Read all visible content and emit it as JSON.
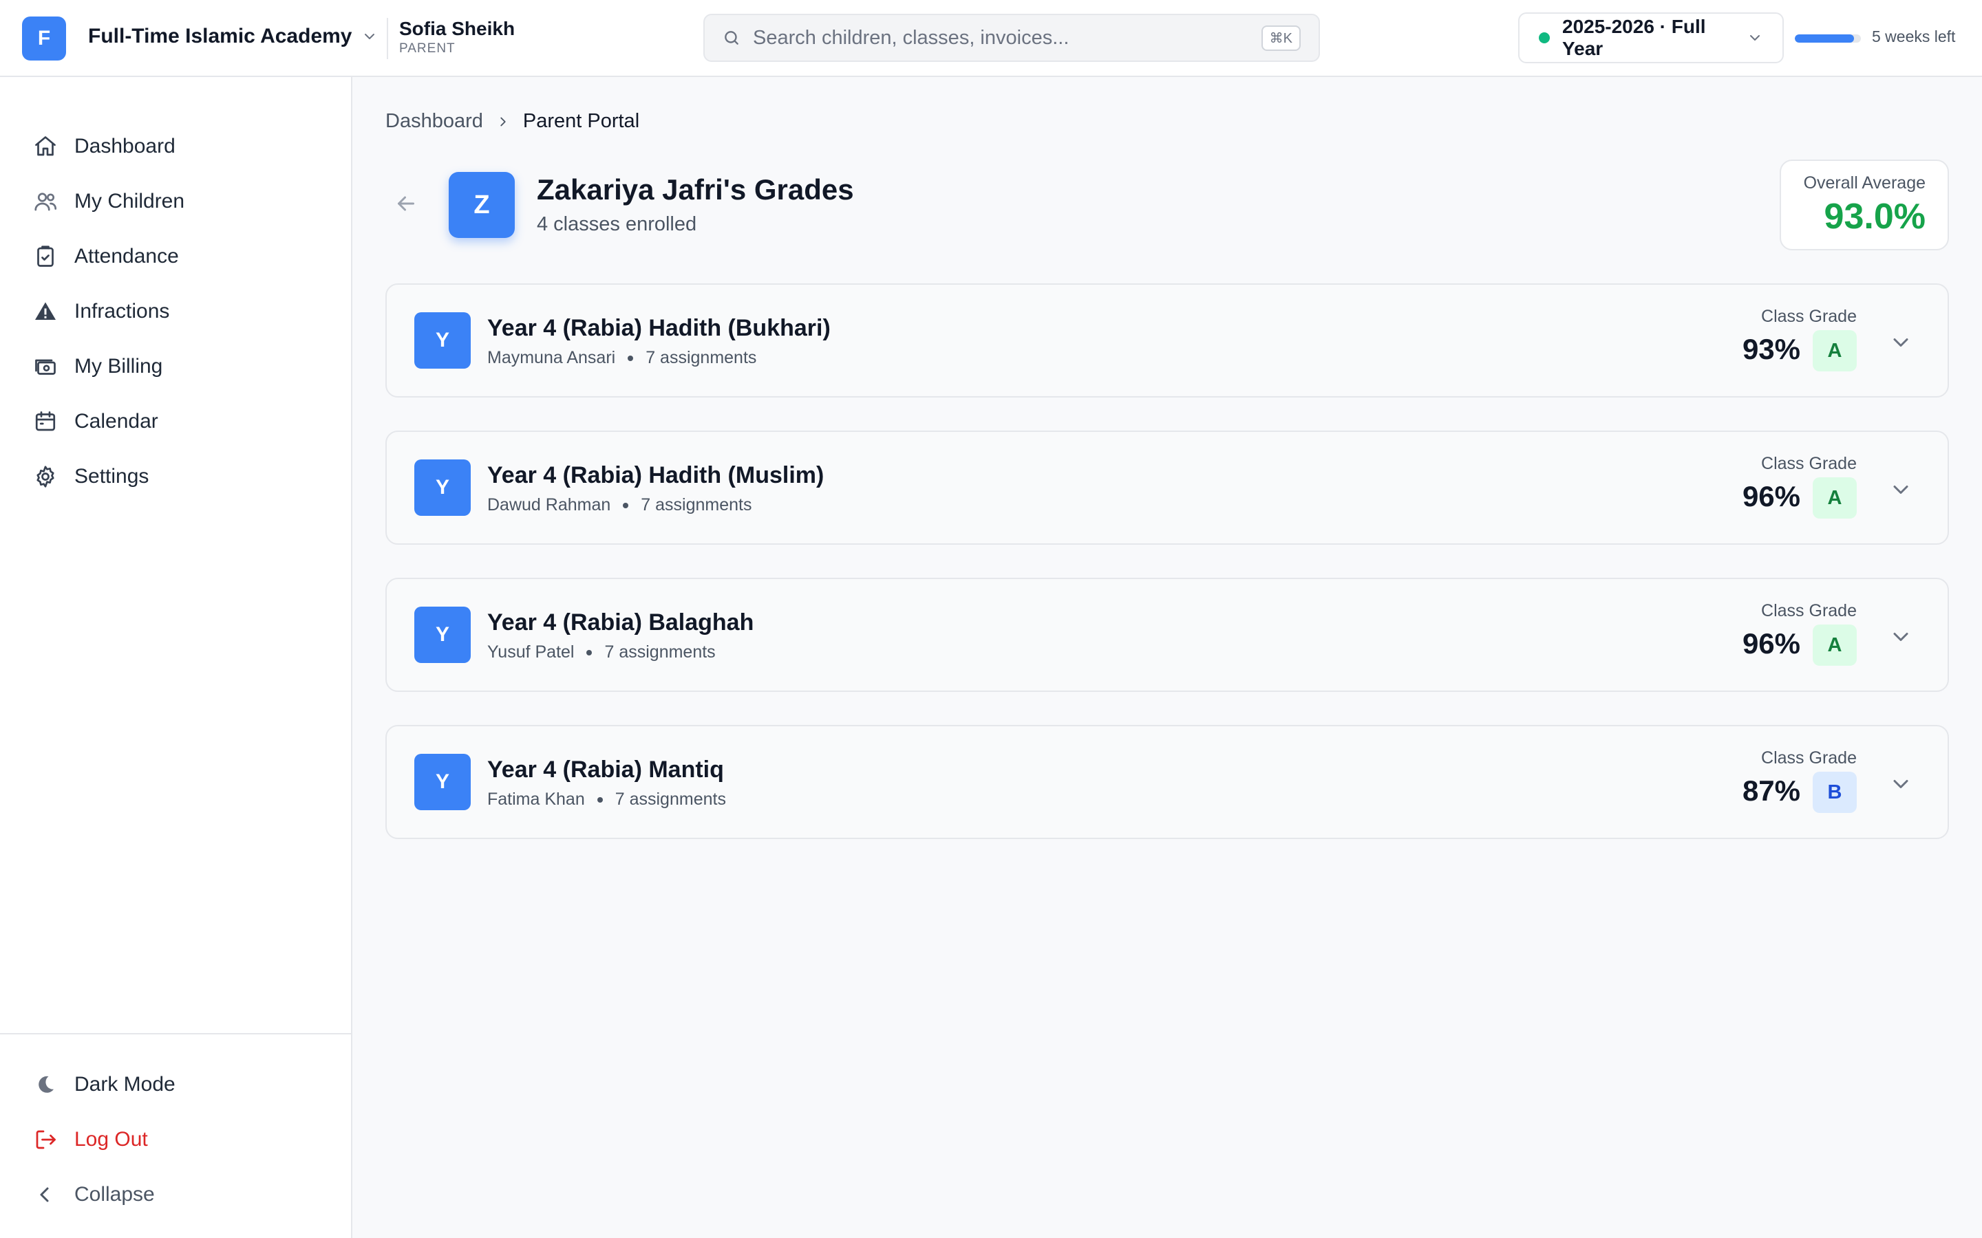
{
  "header": {
    "org_initial": "F",
    "org_name": "Full-Time Islamic Academy",
    "user_name": "Sofia Sheikh",
    "user_role": "PARENT",
    "search_placeholder": "Search children, classes, invoices...",
    "search_shortcut": "⌘K",
    "school_year": "2025-2026 · Full Year",
    "year_progress": 0.9,
    "weeks_left": "5 weeks left"
  },
  "sidebar": {
    "items": [
      {
        "label": "Dashboard",
        "icon": "home-icon"
      },
      {
        "label": "My Children",
        "icon": "users-icon"
      },
      {
        "label": "Attendance",
        "icon": "clipboard-check-icon"
      },
      {
        "label": "Infractions",
        "icon": "warning-icon"
      },
      {
        "label": "My Billing",
        "icon": "billing-icon"
      },
      {
        "label": "Calendar",
        "icon": "calendar-icon"
      },
      {
        "label": "Settings",
        "icon": "gear-icon"
      }
    ],
    "bottom": {
      "dark_mode": "Dark Mode",
      "logout": "Log Out",
      "collapse": "Collapse"
    }
  },
  "breadcrumb": {
    "parent": "Dashboard",
    "current": "Parent Portal"
  },
  "page": {
    "child_initial": "Z",
    "title": "Zakariya Jafri's Grades",
    "subtitle": "4 classes enrolled",
    "overall_label": "Overall Average",
    "overall_value": "93.0%"
  },
  "classes": [
    {
      "initial": "Y",
      "name": "Year 4 (Rabia) Hadith (Bukhari)",
      "teacher": "Maymuna Ansari",
      "assignments": "7 assignments",
      "grade_label": "Class Grade",
      "percent": "93%",
      "letter": "A"
    },
    {
      "initial": "Y",
      "name": "Year 4 (Rabia) Hadith (Muslim)",
      "teacher": "Dawud Rahman",
      "assignments": "7 assignments",
      "grade_label": "Class Grade",
      "percent": "96%",
      "letter": "A"
    },
    {
      "initial": "Y",
      "name": "Year 4 (Rabia) Balaghah",
      "teacher": "Yusuf Patel",
      "assignments": "7 assignments",
      "grade_label": "Class Grade",
      "percent": "96%",
      "letter": "A"
    },
    {
      "initial": "Y",
      "name": "Year 4 (Rabia) Mantiq",
      "teacher": "Fatima Khan",
      "assignments": "7 assignments",
      "grade_label": "Class Grade",
      "percent": "87%",
      "letter": "B"
    }
  ],
  "colors": {
    "accent": "#3b82f6",
    "success": "#16a34a",
    "danger": "#dc2626"
  }
}
